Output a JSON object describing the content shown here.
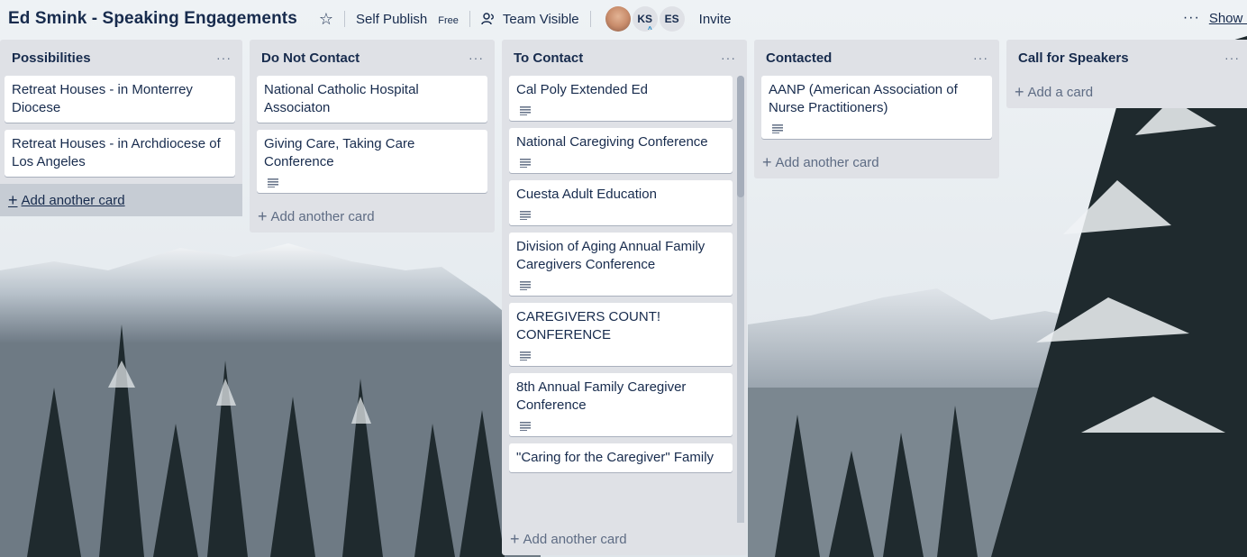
{
  "header": {
    "board_title": "Ed Smink - Speaking Engagements",
    "team_name": "Self Publish",
    "team_badge": "Free",
    "visibility": "Team Visible",
    "members": [
      "KS",
      "ES"
    ],
    "invite": "Invite",
    "show_menu": "Show M"
  },
  "lists": [
    {
      "title": "Possibilities",
      "cards": [
        {
          "text": "Retreat Houses - in Monterrey Diocese",
          "has_description": false
        },
        {
          "text": "Retreat Houses - in Archdiocese of Los Angeles",
          "has_description": false
        }
      ],
      "add_label": "Add another card"
    },
    {
      "title": "Do Not Contact",
      "cards": [
        {
          "text": "National Catholic Hospital Associaton",
          "has_description": false
        },
        {
          "text": "Giving Care, Taking Care Conference",
          "has_description": true
        }
      ],
      "add_label": "Add another card"
    },
    {
      "title": "To Contact",
      "cards": [
        {
          "text": "Cal Poly Extended Ed",
          "has_description": true
        },
        {
          "text": "National Caregiving Conference",
          "has_description": true
        },
        {
          "text": "Cuesta Adult Education",
          "has_description": true
        },
        {
          "text": "Division of Aging Annual Family Caregivers Conference",
          "has_description": true
        },
        {
          "text": "CAREGIVERS COUNT! CONFERENCE",
          "has_description": true
        },
        {
          "text": "8th Annual Family Caregiver Conference",
          "has_description": true
        },
        {
          "text": "\"Caring for the Caregiver\" Family",
          "has_description": false
        }
      ],
      "add_label": "Add another card"
    },
    {
      "title": "Contacted",
      "cards": [
        {
          "text": "AANP (American Association of Nurse Practitioners)",
          "has_description": true
        }
      ],
      "add_label": "Add another card"
    },
    {
      "title": "Call for Speakers",
      "cards": [],
      "add_label": "Add a card"
    }
  ]
}
